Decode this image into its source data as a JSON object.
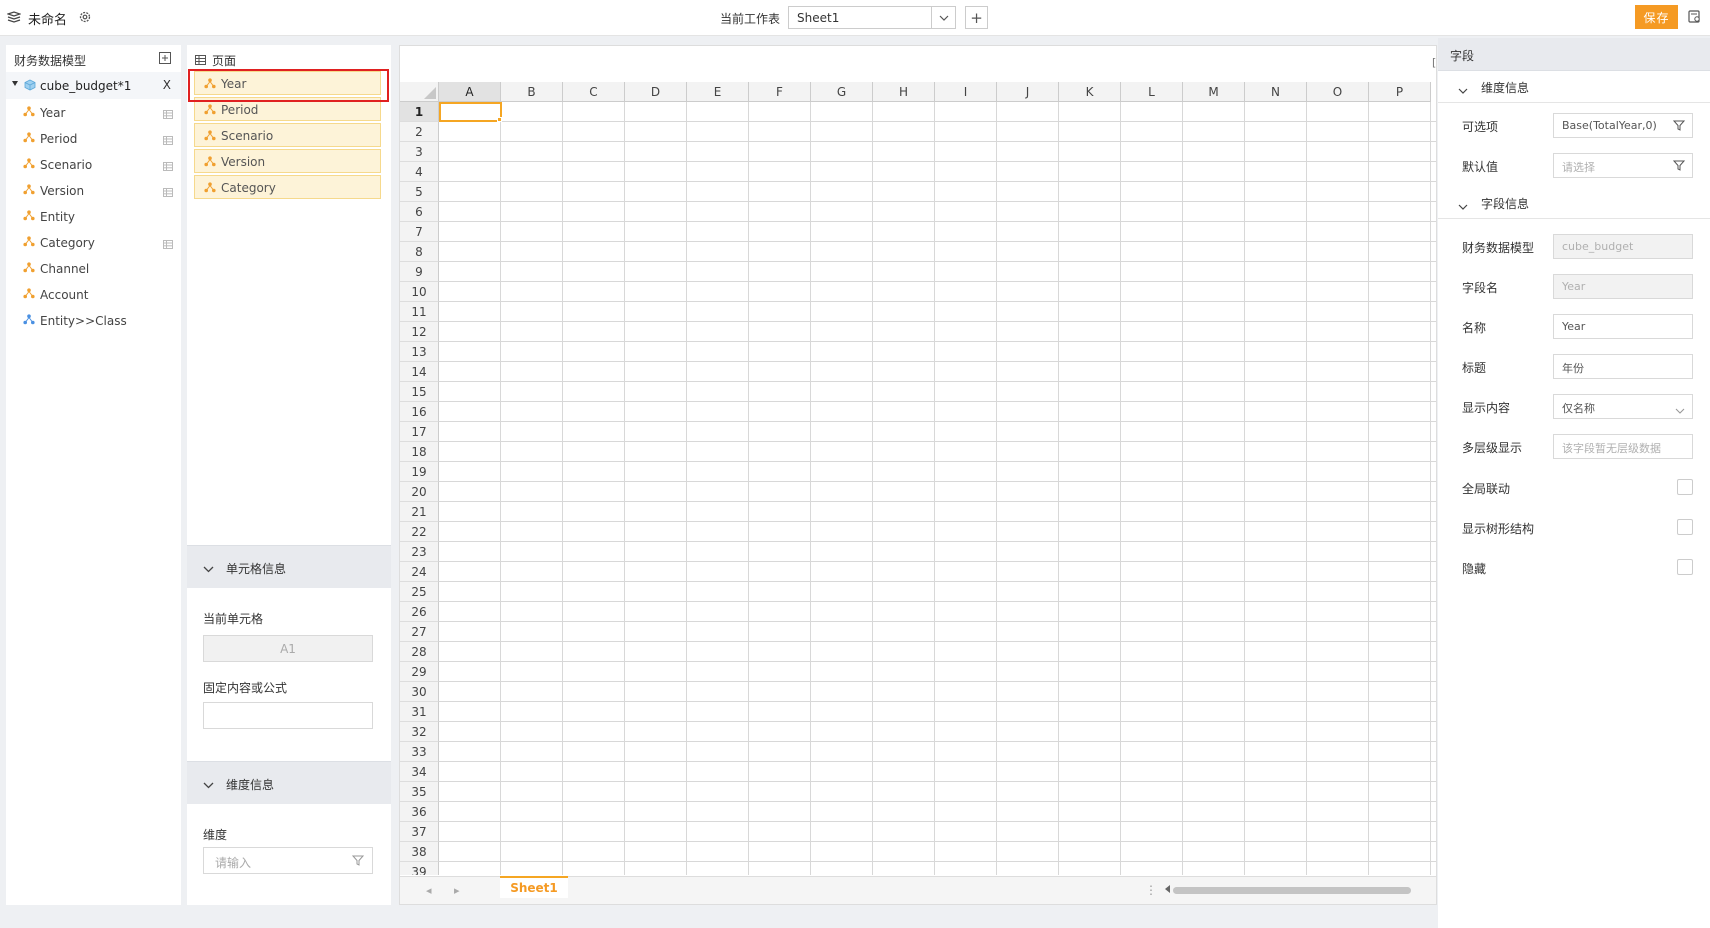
{
  "header": {
    "doc_title": "未命名",
    "sheet_label": "当前工作表",
    "sheet_value": "Sheet1",
    "add_label": "+",
    "save_label": "保存"
  },
  "model": {
    "title": "财务数据模型",
    "cube_name": "cube_budget*1",
    "close_label": "X",
    "items": [
      {
        "label": "Year"
      },
      {
        "label": "Period"
      },
      {
        "label": "Scenario"
      },
      {
        "label": "Version"
      },
      {
        "label": "Entity"
      },
      {
        "label": "Category"
      },
      {
        "label": "Channel"
      },
      {
        "label": "Account"
      },
      {
        "label": "Entity>>Class"
      }
    ]
  },
  "page": {
    "title": "页面",
    "items": [
      {
        "label": "Year"
      },
      {
        "label": "Period"
      },
      {
        "label": "Scenario"
      },
      {
        "label": "Version"
      },
      {
        "label": "Category"
      }
    ],
    "cell_section": {
      "title": "单元格信息",
      "current_cell_label": "当前单元格",
      "current_cell_value": "A1",
      "formula_label": "固定内容或公式",
      "formula_value": ""
    },
    "dim_section": {
      "title": "维度信息",
      "dim_label": "维度",
      "dim_placeholder": "请输入"
    }
  },
  "sheet": {
    "columns": [
      "A",
      "B",
      "C",
      "D",
      "E",
      "F",
      "G",
      "H",
      "I",
      "J",
      "K",
      "L",
      "M",
      "N",
      "O",
      "P"
    ],
    "rows": [
      "1",
      "2",
      "3",
      "4",
      "5",
      "6",
      "7",
      "8",
      "9",
      "10",
      "11",
      "12",
      "13",
      "14",
      "15",
      "16",
      "17",
      "18",
      "19",
      "20",
      "21",
      "22",
      "23",
      "24",
      "25",
      "26",
      "27",
      "28",
      "29",
      "30",
      "31",
      "32",
      "33",
      "34",
      "35",
      "36",
      "37",
      "38",
      "39"
    ],
    "active_cell": "A1",
    "tab_name": "Sheet1",
    "gutter_char": "[",
    "dots": "⋮",
    "nav_prev": "◂",
    "nav_next": "▸"
  },
  "props": {
    "title": "字段",
    "dim_info": {
      "title": "维度信息",
      "option_label": "可选项",
      "option_value": "Base(TotalYear,0)",
      "default_label": "默认值",
      "default_placeholder": "请选择"
    },
    "field_info": {
      "title": "字段信息",
      "model_label": "财务数据模型",
      "model_value": "cube_budget",
      "field_name_label": "字段名",
      "field_name_value": "Year",
      "name_label": "名称",
      "name_value": "Year",
      "caption_label": "标题",
      "caption_value": "年份",
      "display_label": "显示内容",
      "display_value": "仅名称",
      "multilevel_label": "多层级显示",
      "multilevel_placeholder": "该字段暂无层级数据",
      "global_link_label": "全局联动",
      "global_link_checked": false,
      "tree_label": "显示树形结构",
      "tree_checked": false,
      "hide_label": "隐藏",
      "hide_checked": false
    }
  },
  "colors": {
    "accent": "#f59a23",
    "highlight_border": "#e02020",
    "dim_icon": "#f0a030",
    "link_icon": "#4a90e2",
    "page_item_bg": "#fdf3d8"
  }
}
